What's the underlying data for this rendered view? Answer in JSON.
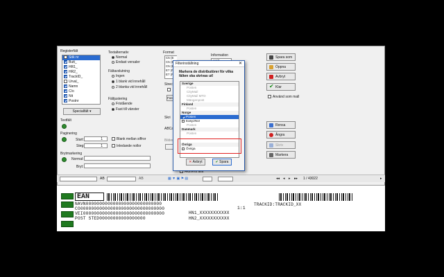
{
  "left_panel": {
    "registerfalt_label": "Registerfält",
    "items": [
      {
        "label": "Sök nr",
        "checked": false,
        "selected": true
      },
      {
        "label": "Butt_",
        "checked": true
      },
      {
        "label": "HR1_",
        "checked": true
      },
      {
        "label": "HR2_",
        "checked": true
      },
      {
        "label": "TrackID_",
        "checked": true
      },
      {
        "label": "Urval_",
        "checked": false
      },
      {
        "label": "Namn",
        "checked": true
      },
      {
        "label": "C/o",
        "checked": true
      },
      {
        "label": "Nit",
        "checked": true
      },
      {
        "label": "Postnr",
        "checked": true
      }
    ],
    "specialfalt_button": "Specialfält",
    "textfalt_label": "Textfält",
    "paginering_label": "Paginering",
    "start_label": "Start:",
    "start_value": "1",
    "steg_label": "Steg:",
    "steg_value": "1",
    "blank_mellan_siffror": "Blank mellan siffror",
    "inledande_nollor": "Inledande nollor",
    "brytmarkering_label": "Brytmarkering",
    "normal_label": "Normal:",
    "bryt_label": "Bryt:"
  },
  "textalternativ": {
    "label": "Textalternativ",
    "options": [
      "Normal",
      "Endast versaler"
    ],
    "fallavslutning_label": "Fältavslutning",
    "fall_options": [
      "Ingen",
      "1 blank vid innehåll",
      "2 blanka vid innehåll"
    ],
    "faltgutering_label": "Fältjustering",
    "just_options": [
      "Fristående",
      "Fast till vänster"
    ]
  },
  "middle": {
    "format_label": "Format",
    "format_items": [
      "C5 (E",
      "C5 (E",
      "C5 (E",
      "E7 (Fr",
      "E7 (Fr"
    ],
    "information_label": "Information",
    "info_rows": [
      "Höjd",
      "Bredd"
    ],
    "strecken_label": "Strecke",
    "fastighetsplan_label": "Fasti",
    "skrivare_label": "Skri",
    "abc_label": "ABCai",
    "bilder_label": "Bilder",
    "aktivera_alla": "Aktivera alla"
  },
  "right_buttons": {
    "spara_som": "Spara som",
    "oppna": "Öppna",
    "avbryt": "Avbryt",
    "klar": "Klar",
    "anvand_som_mall": "Använd som mall",
    "rensa": "Rensa",
    "angra": "Ångra",
    "skriv": "Skriv",
    "markera": "Markera"
  },
  "dialog": {
    "title": "Filterinställning",
    "heading": "Markera de distributörer för vilka fälten ska skrivas ut!",
    "groups": [
      {
        "name": "Sverige",
        "items": [
          {
            "label": "Posten",
            "checked": false,
            "dark": false
          },
          {
            "label": "CityMail",
            "checked": false,
            "dark": false
          },
          {
            "label": "CityMail MTD",
            "checked": false,
            "dark": false
          },
          {
            "label": "Mängenpost",
            "checked": false,
            "dark": false
          }
        ]
      },
      {
        "name": "Finland",
        "items": [
          {
            "label": "Posten",
            "checked": false,
            "dark": false
          }
        ]
      },
      {
        "name": "Norge",
        "items": [
          {
            "label": "Posten",
            "checked": true,
            "dark": true,
            "selected": true
          },
          {
            "label": "Easy2Nor",
            "checked": false,
            "dark": true
          },
          {
            "label": "Posten",
            "checked": false,
            "dark": false
          }
        ]
      },
      {
        "name": "Danmark",
        "items": [
          {
            "label": "Posten",
            "checked": false,
            "dark": false
          }
        ]
      }
    ],
    "ovriga_group": "Övriga",
    "ovriga_item": "Övriga",
    "avbryt_button": "Avbryt",
    "spara_button": "Spara"
  },
  "toolbar": {
    "font_sample": "AB",
    "zoom_sample": "AB",
    "page_info": "1 / 43022"
  },
  "preview": {
    "ean": "EAN",
    "line1": "NAVN0000000000000000000000000000",
    "line2": "CO0000000000000000000000000000000",
    "line3": "VEI000000000000000000000000000000",
    "line4": "POST STED00000000000000000",
    "page_marker": "1:1",
    "track_id": "TRACKID:TRACKID_XX",
    "hn1": "HN1_XXXXXXXXXXX",
    "hn2": "HN2_XXXXXXXXXXX"
  },
  "colors": {
    "accent": "#2a6bd0",
    "green": "#2e8b2e",
    "highlight_box": "#e02020"
  }
}
